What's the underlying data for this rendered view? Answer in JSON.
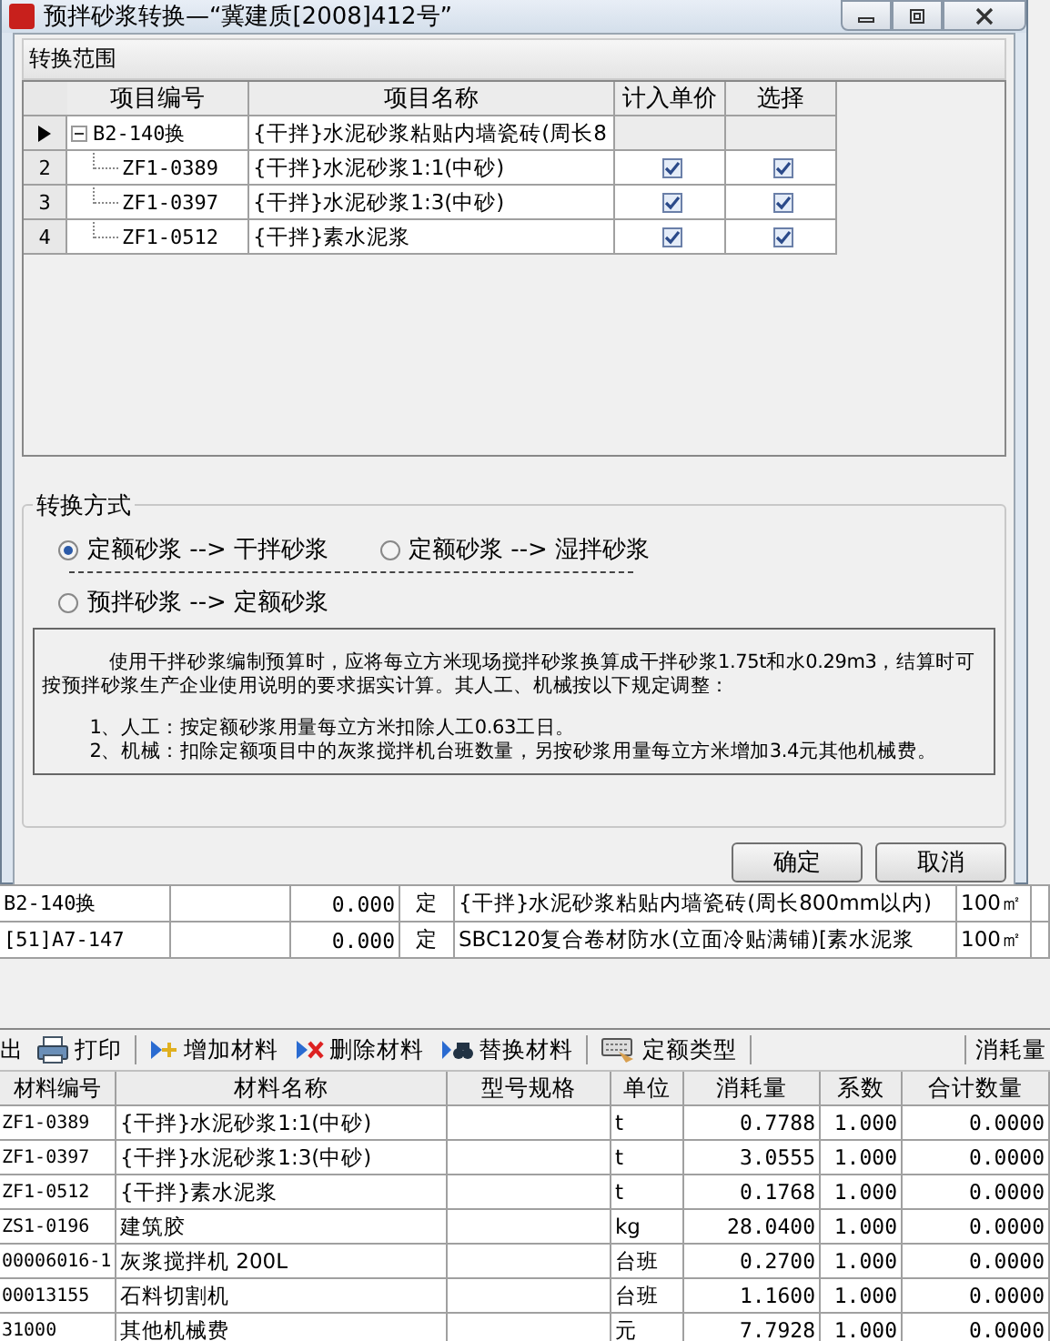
{
  "dialog": {
    "title": "预拌砂浆转换—“冀建质[2008]412号”",
    "range_group": {
      "title": "转换范围",
      "columns": [
        "项目编号",
        "项目名称",
        "计入单价",
        "选择"
      ],
      "rows": [
        {
          "current": true,
          "code": "B2-140换",
          "name": "{干拌}水泥砂浆粘贴内墙瓷砖(周长8",
          "expanded": true,
          "children": [
            {
              "current": false,
              "number": "2",
              "code": "ZF1-0389",
              "name": "{干拌}水泥砂浆1:1(中砂)",
              "include_price": true,
              "select": true
            },
            {
              "current": false,
              "number": "3",
              "code": "ZF1-0397",
              "name": "{干拌}水泥砂浆1:3(中砂)",
              "include_price": true,
              "select": true
            },
            {
              "current": false,
              "number": "4",
              "code": "ZF1-0512",
              "name": "{干拌}素水泥浆",
              "include_price": true,
              "select": true
            }
          ]
        }
      ]
    },
    "method_group": {
      "title": "转换方式",
      "options": [
        {
          "label": "定额砂浆 --> 干拌砂浆",
          "selected": true
        },
        {
          "label": "定额砂浆 --> 湿拌砂浆",
          "selected": false
        },
        {
          "label": "预拌砂浆 --> 定额砂浆",
          "selected": false
        }
      ],
      "note": {
        "paragraph": "使用干拌砂浆编制预算时，应将每立方米现场搅拌砂浆换算成干拌砂浆1.75t和水0.29m3，结算时可按预拌砂浆生产企业使用说明的要求据实计算。其人工、机械按以下规定调整：",
        "items": [
          "1、人工：按定额砂浆用量每立方米扣除人工0.63工日。",
          "2、机械：扣除定额项目中的灰浆搅拌机台班数量，另按砂浆用量每立方米增加3.4元其他机械费。"
        ]
      }
    },
    "buttons": [
      "确定",
      "取消"
    ]
  },
  "quota_rows": [
    {
      "code": "B2-140换",
      "quantity": "0.000",
      "type": "定",
      "name": "{干拌}水泥砂浆粘贴内墙瓷砖(周长800mm以内)",
      "unit": "100㎡"
    },
    {
      "code": "[51]A7-147",
      "quantity": "0.000",
      "type": "定",
      "name": "SBC120复合卷材防水(立面冷贴满铺)[素水泥浆",
      "unit": "100㎡"
    }
  ],
  "toolbar": {
    "cut_label": "出",
    "items": [
      {
        "kind": "print",
        "label": "打印"
      },
      {
        "kind": "add",
        "label": "增加材料"
      },
      {
        "kind": "delete",
        "label": "删除材料"
      },
      {
        "kind": "replace",
        "label": "替换材料"
      },
      {
        "kind": "quota",
        "label": "定额类型"
      }
    ],
    "right_label": "消耗量"
  },
  "materials": {
    "columns": [
      "材料编号",
      "材料名称",
      "型号规格",
      "单位",
      "消耗量",
      "系数",
      "合计数量"
    ],
    "rows": [
      {
        "code": "ZF1-0389",
        "name": "{干拌}水泥砂浆1:1(中砂)",
        "unit": "t",
        "consumption": "0.7788",
        "factor": "1.000",
        "total": "0.0000"
      },
      {
        "code": "ZF1-0397",
        "name": "{干拌}水泥砂浆1:3(中砂)",
        "unit": "t",
        "consumption": "3.0555",
        "factor": "1.000",
        "total": "0.0000"
      },
      {
        "code": "ZF1-0512",
        "name": "{干拌}素水泥浆",
        "unit": "t",
        "consumption": "0.1768",
        "factor": "1.000",
        "total": "0.0000"
      },
      {
        "code": "ZS1-0196",
        "name": "建筑胶",
        "unit": "kg",
        "consumption": "28.0400",
        "factor": "1.000",
        "total": "0.0000"
      },
      {
        "code": "00006016-1",
        "name": "灰浆搅拌机 200L",
        "unit": "台班",
        "consumption": "0.2700",
        "factor": "1.000",
        "total": "0.0000"
      },
      {
        "code": "00013155",
        "name": "石料切割机",
        "unit": "台班",
        "consumption": "1.1600",
        "factor": "1.000",
        "total": "0.0000"
      },
      {
        "code": "31000",
        "name": "其他机械费",
        "unit": "元",
        "consumption": "7.7928",
        "factor": "1.000",
        "total": "0.0000"
      }
    ]
  }
}
